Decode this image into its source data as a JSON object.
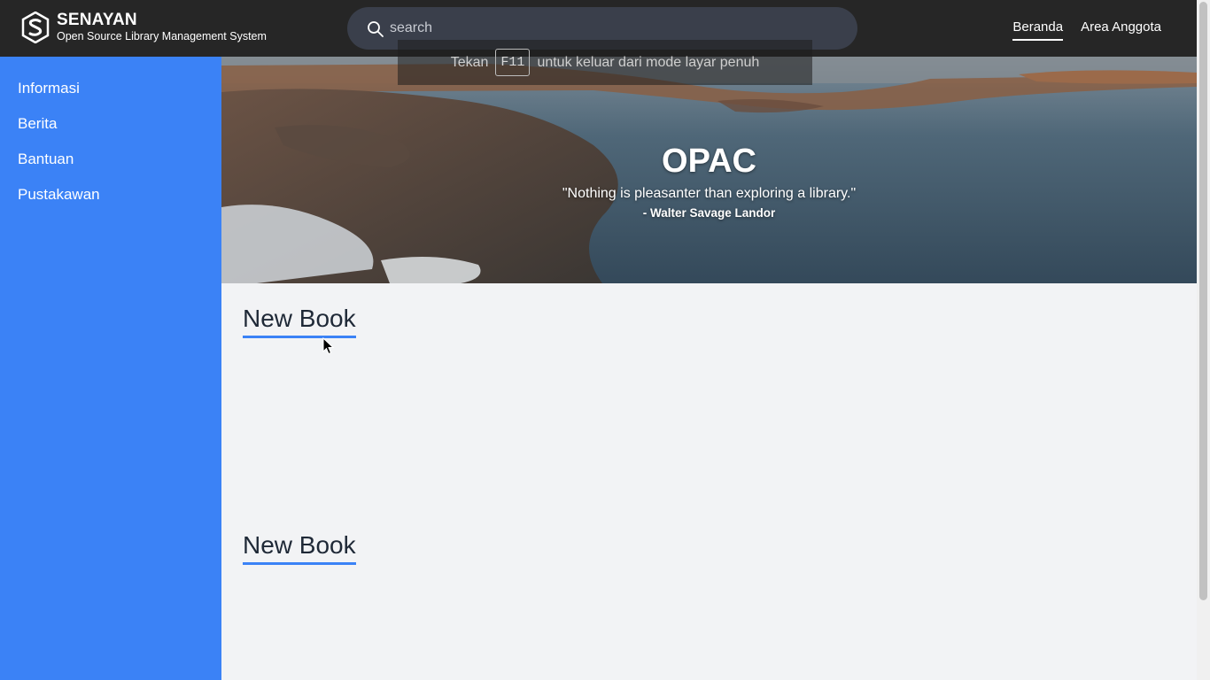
{
  "brand": {
    "title": "SENAYAN",
    "subtitle": "Open Source Library Management System",
    "logo_icon": "slims-logo-icon"
  },
  "search": {
    "placeholder": "search",
    "value": ""
  },
  "nav": {
    "items": [
      {
        "label": "Beranda",
        "active": true
      },
      {
        "label": "Area Anggota",
        "active": false
      }
    ]
  },
  "sidebar": {
    "items": [
      {
        "label": "Informasi"
      },
      {
        "label": "Berita"
      },
      {
        "label": "Bantuan"
      },
      {
        "label": "Pustakawan"
      }
    ]
  },
  "hero": {
    "title": "OPAC",
    "quote": "\"Nothing is pleasanter than exploring a library.\"",
    "author": "- Walter Savage Landor"
  },
  "fullscreen_notice": {
    "before": "Tekan",
    "key": "F11",
    "after": "untuk keluar dari mode layar penuh"
  },
  "sections": [
    {
      "title": "New Book"
    },
    {
      "title": "New Book"
    }
  ],
  "colors": {
    "topbar": "#262626",
    "sidebar": "#3b82f6",
    "content_bg": "#f2f3f5",
    "accent": "#3b82f6"
  }
}
